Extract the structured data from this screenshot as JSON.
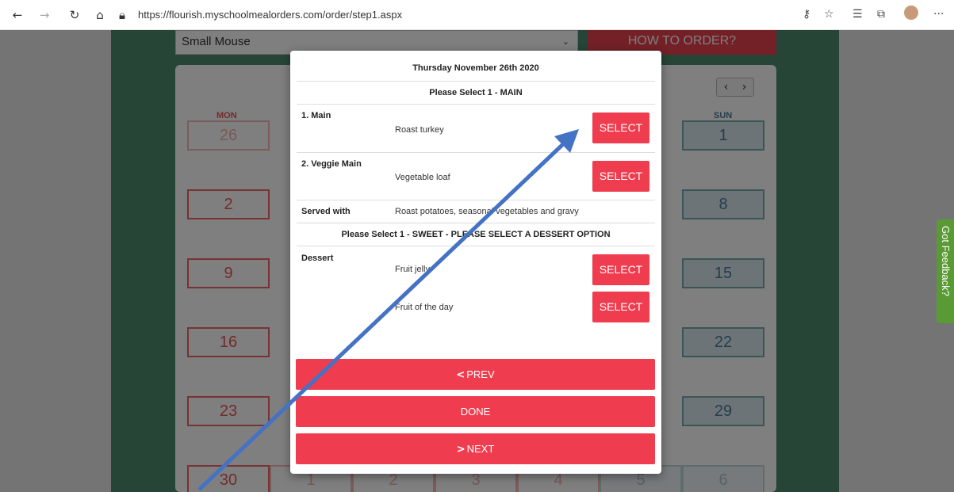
{
  "browser": {
    "url": "https://flourish.myschoolmealorders.com/order/step1.aspx"
  },
  "page": {
    "child_name": "Small Mouse",
    "how_to_order": "HOW TO ORDER?",
    "calendar": {
      "day_headers": [
        {
          "label": "MON",
          "color": "#e45757"
        },
        {
          "label": "SUN",
          "color": "#4b7a9a"
        }
      ],
      "mon_dates": [
        "26",
        "2",
        "9",
        "16",
        "23",
        "30"
      ],
      "sun_dates": [
        "1",
        "8",
        "15",
        "22",
        "29",
        "6"
      ],
      "bottom_row": [
        "1",
        "2",
        "3",
        "4",
        "5"
      ]
    },
    "feedback": "Got Feedback?"
  },
  "modal": {
    "date": "Thursday November 26th 2020",
    "main_header": "Please Select 1 - MAIN",
    "main_items": [
      {
        "label": "1. Main",
        "item": "Roast turkey",
        "button": "SELECT"
      },
      {
        "label": "2. Veggie Main",
        "item": "Vegetable loaf",
        "button": "SELECT"
      }
    ],
    "served_with_label": "Served with",
    "served_with": "Roast potatoes, seasonal vegetables and gravy",
    "sweet_header": "Please Select 1 - SWEET - PLEASE SELECT A DESSERT OPTION",
    "dessert_label": "Dessert",
    "desserts": [
      {
        "item": "Fruit jelly",
        "button": "SELECT"
      },
      {
        "item": "Fruit of the day",
        "button": "SELECT"
      }
    ],
    "prev": "PREV",
    "done": "DONE",
    "next": "NEXT"
  },
  "colors": {
    "accent_red": "#ef3d4f",
    "green_panel": "#4c8a6d",
    "annotation_arrow": "#4472c4"
  },
  "icons": [
    "back-arrow-icon",
    "forward-arrow-icon",
    "refresh-icon",
    "home-icon",
    "lock-icon",
    "key-icon",
    "star-icon",
    "favorites-icon",
    "collections-icon",
    "profile-icon",
    "more-icon",
    "chevron-left-icon",
    "chevron-right-icon",
    "dropdown-caret-icon"
  ]
}
